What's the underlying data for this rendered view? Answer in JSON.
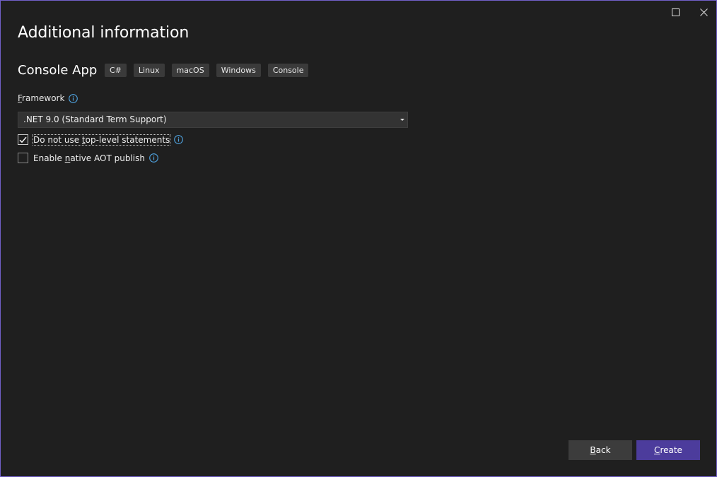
{
  "window": {
    "title": "Additional information",
    "border_color": "#7160c8",
    "background": "#1f1f1f"
  },
  "template": {
    "name": "Console App",
    "tags": [
      "C#",
      "Linux",
      "macOS",
      "Windows",
      "Console"
    ]
  },
  "framework": {
    "label_mnemonic": "F",
    "label_rest": "ramework",
    "selected": ".NET 9.0 (Standard Term Support)"
  },
  "options": [
    {
      "label_before": "Do not use ",
      "label_mnemonic": "t",
      "label_after": "op-level statements",
      "checked": true
    },
    {
      "label_before": "Enable ",
      "label_mnemonic": "n",
      "label_after": "ative AOT publish",
      "checked": false
    }
  ],
  "buttons": {
    "back_mnemonic": "B",
    "back_rest": "ack",
    "create_mnemonic": "C",
    "create_rest": "reate",
    "create_color": "#4c3c9c"
  },
  "icons": {
    "maximize": "maximize-icon",
    "close": "close-icon",
    "info": "info-icon",
    "checkmark": "checkmark-icon",
    "dropdown": "chevron-down-icon"
  }
}
